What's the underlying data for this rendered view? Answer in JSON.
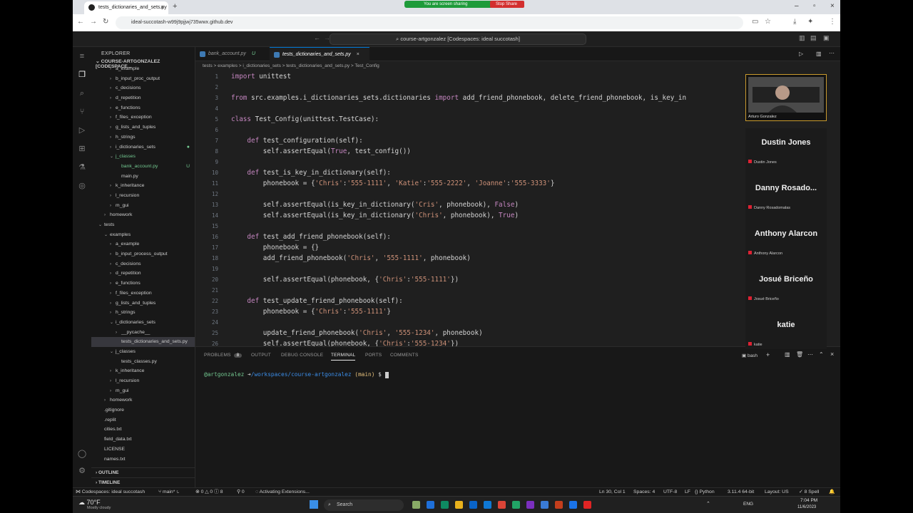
{
  "browser": {
    "tab_title": "tests_dictionaries_and_sets.py",
    "url": "ideal-succotash-w99j9pjjwj735wwx.github.dev",
    "sharing_text": "You are screen sharing",
    "stop_share": "Stop Share"
  },
  "vscode": {
    "command_center": "course-artgonzalez [Codespaces: ideal succotash]",
    "explorer_title": "EXPLORER",
    "root_folder": "COURSE-ARTGONZALEZ [CODESPACE...",
    "tree": [
      {
        "label": "a_example",
        "indent": 3,
        "twisty": ">"
      },
      {
        "label": "b_input_proc_output",
        "indent": 3,
        "twisty": ">"
      },
      {
        "label": "c_decisions",
        "indent": 3,
        "twisty": ">"
      },
      {
        "label": "d_repetition",
        "indent": 3,
        "twisty": ">"
      },
      {
        "label": "e_functions",
        "indent": 3,
        "twisty": ">"
      },
      {
        "label": "f_files_exception",
        "indent": 3,
        "twisty": ">"
      },
      {
        "label": "g_lists_and_tuples",
        "indent": 3,
        "twisty": ">"
      },
      {
        "label": "h_strings",
        "indent": 3,
        "twisty": ">"
      },
      {
        "label": "i_dictionaries_sets",
        "indent": 3,
        "twisty": ">",
        "dot": true
      },
      {
        "label": "j_classes",
        "indent": 3,
        "twisty": "v",
        "mod": true
      },
      {
        "label": "bank_account.py",
        "indent": 4,
        "twisty": "",
        "mod": true,
        "git": "U"
      },
      {
        "label": "main.py",
        "indent": 4,
        "twisty": ""
      },
      {
        "label": "k_inheritance",
        "indent": 3,
        "twisty": ">"
      },
      {
        "label": "l_recursion",
        "indent": 3,
        "twisty": ">"
      },
      {
        "label": "m_gui",
        "indent": 3,
        "twisty": ">"
      },
      {
        "label": "homework",
        "indent": 2,
        "twisty": ">"
      },
      {
        "label": "tests",
        "indent": 1,
        "twisty": "v"
      },
      {
        "label": "examples",
        "indent": 2,
        "twisty": "v"
      },
      {
        "label": "a_example",
        "indent": 3,
        "twisty": ">"
      },
      {
        "label": "b_input_process_output",
        "indent": 3,
        "twisty": ">"
      },
      {
        "label": "c_decisions",
        "indent": 3,
        "twisty": ">"
      },
      {
        "label": "d_repetition",
        "indent": 3,
        "twisty": ">"
      },
      {
        "label": "e_functions",
        "indent": 3,
        "twisty": ">"
      },
      {
        "label": "f_files_exception",
        "indent": 3,
        "twisty": ">"
      },
      {
        "label": "g_lists_and_tuples",
        "indent": 3,
        "twisty": ">"
      },
      {
        "label": "h_strings",
        "indent": 3,
        "twisty": ">"
      },
      {
        "label": "i_dictionaries_sets",
        "indent": 3,
        "twisty": "v"
      },
      {
        "label": "__pycache__",
        "indent": 4,
        "twisty": ">"
      },
      {
        "label": "tests_dictionaries_and_sets.py",
        "indent": 4,
        "twisty": "",
        "selected": true
      },
      {
        "label": "j_classes",
        "indent": 3,
        "twisty": "v"
      },
      {
        "label": "tests_classes.py",
        "indent": 4,
        "twisty": ""
      },
      {
        "label": "k_inheritance",
        "indent": 3,
        "twisty": ">"
      },
      {
        "label": "l_recursion",
        "indent": 3,
        "twisty": ">"
      },
      {
        "label": "m_gui",
        "indent": 3,
        "twisty": ">"
      },
      {
        "label": "homework",
        "indent": 2,
        "twisty": ">"
      },
      {
        "label": ".gitignore",
        "indent": 1,
        "twisty": ""
      },
      {
        "label": ".replit",
        "indent": 1,
        "twisty": ""
      },
      {
        "label": "cities.txt",
        "indent": 1,
        "twisty": ""
      },
      {
        "label": "field_data.txt",
        "indent": 1,
        "twisty": ""
      },
      {
        "label": "LICENSE",
        "indent": 1,
        "twisty": ""
      },
      {
        "label": "names.txt",
        "indent": 1,
        "twisty": ""
      }
    ],
    "outline_label": "OUTLINE",
    "timeline_label": "TIMELINE",
    "tabs": [
      {
        "label": "bank_account.py",
        "marker": "U"
      },
      {
        "label": "tests_dictionaries_and_sets.py",
        "marker": "×"
      }
    ],
    "breadcrumbs": "tests  >  examples  >  i_dictionaries_sets  >  tests_dictionaries_and_sets.py  >  Test_Config",
    "code_lines": [
      {
        "n": "1",
        "t": "import unittest"
      },
      {
        "n": "2",
        "t": ""
      },
      {
        "n": "3",
        "t": "from src.examples.i_dictionaries_sets.dictionaries import add_friend_phonebook, delete_friend_phonebook, is_key_in"
      },
      {
        "n": "4",
        "t": ""
      },
      {
        "n": "5",
        "t": "class Test_Config(unittest.TestCase):"
      },
      {
        "n": "6",
        "t": ""
      },
      {
        "n": "7",
        "t": "    def test_configuration(self):"
      },
      {
        "n": "8",
        "t": "        self.assertEqual(True, test_config())"
      },
      {
        "n": "9",
        "t": ""
      },
      {
        "n": "10",
        "t": "    def test_is_key_in_dictionary(self):"
      },
      {
        "n": "11",
        "t": "        phonebook = {'Chris':'555-1111', 'Katie':'555-2222', 'Joanne':'555-3333'}"
      },
      {
        "n": "12",
        "t": ""
      },
      {
        "n": "13",
        "t": "        self.assertEqual(is_key_in_dictionary('Cris', phonebook), False)"
      },
      {
        "n": "14",
        "t": "        self.assertEqual(is_key_in_dictionary('Chris', phonebook), True)"
      },
      {
        "n": "15",
        "t": ""
      },
      {
        "n": "16",
        "t": "    def test_add_friend_phonebook(self):"
      },
      {
        "n": "17",
        "t": "        phonebook = {}"
      },
      {
        "n": "18",
        "t": "        add_friend_phonebook('Chris', '555-1111', phonebook)"
      },
      {
        "n": "19",
        "t": ""
      },
      {
        "n": "20",
        "t": "        self.assertEqual(phonebook, {'Chris':'555-1111'})"
      },
      {
        "n": "21",
        "t": ""
      },
      {
        "n": "22",
        "t": "    def test_update_friend_phonebook(self):"
      },
      {
        "n": "23",
        "t": "        phonebook = {'Chris':'555-1111'}"
      },
      {
        "n": "24",
        "t": ""
      },
      {
        "n": "25",
        "t": "        update_friend_phonebook('Chris', '555-1234', phonebook)"
      },
      {
        "n": "26",
        "t": "        self.assertEqual(phonebook, {'Chris':'555-1234'})"
      }
    ],
    "panel_tabs": [
      "PROBLEMS",
      "OUTPUT",
      "DEBUG CONSOLE",
      "TERMINAL",
      "PORTS",
      "COMMENTS"
    ],
    "problems_count": "8",
    "terminal_shell": "bash",
    "terminal_user": "@artgonzalez",
    "terminal_path": "/workspaces/course-artgonzalez",
    "terminal_branch": "(main)",
    "terminal_prompt": "$",
    "status": {
      "remote": "Codespaces: ideal succotash",
      "branch": "main*",
      "errors": "0",
      "warnings": "0",
      "infos": "8",
      "ports": "0",
      "activity": "Activating Extensions...",
      "cursor": "Ln 30, Col 1",
      "spaces": "Spaces: 4",
      "encoding": "UTF-8",
      "eol": "LF",
      "language": "Python",
      "interpreter": "3.11.4 64-bit",
      "layout": "Layout: US",
      "spell": "8 Spell"
    }
  },
  "meeting": {
    "presenter": "Arturo Gonzalez",
    "participants": [
      {
        "name": "Dustin Jones",
        "sub": "Dustin Jones"
      },
      {
        "name": "Danny  Rosado...",
        "sub": "Danny Rosadomalas"
      },
      {
        "name": "Anthony Alarcon",
        "sub": "Anthony Alarcon"
      },
      {
        "name": "Josué Briceño",
        "sub": "Josué Briceño"
      },
      {
        "name": "katie",
        "sub": "katie"
      }
    ]
  },
  "taskbar": {
    "weather_temp": "70°F",
    "weather_desc": "Mostly cloudy",
    "search_label": "Search",
    "lang": "ENG",
    "time": "7:04 PM",
    "date": "11/6/2023"
  }
}
